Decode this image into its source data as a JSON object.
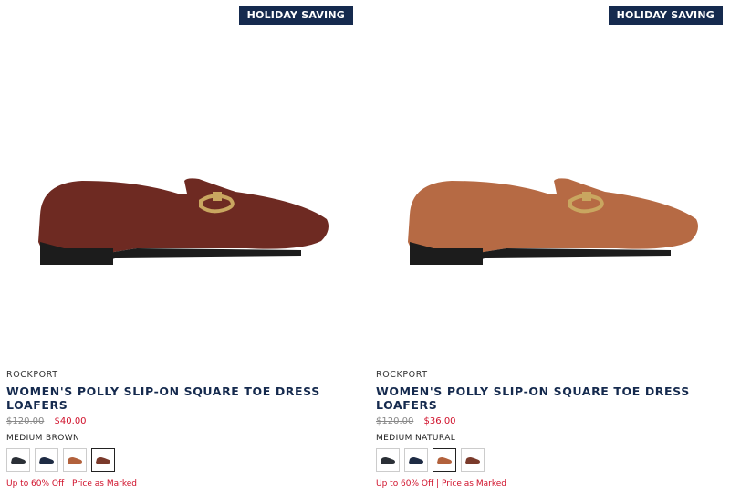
{
  "products": [
    {
      "badge": "HOLIDAY SAVING",
      "brand": "ROCKPORT",
      "title": "WOMEN'S POLLY SLIP-ON SQUARE TOE DRESS LOAFERS",
      "original_price": "$120.00",
      "sale_price": "$40.00",
      "color_label": "MEDIUM BROWN",
      "shoe_color": "#6e2a22",
      "swatches": [
        {
          "color": "#2a2f36",
          "selected": false
        },
        {
          "color": "#1e2b44",
          "selected": false
        },
        {
          "color": "#b2613c",
          "selected": false
        },
        {
          "color": "#7a3a2b",
          "selected": true
        }
      ],
      "promo": "Up to 60% Off | Price as Marked"
    },
    {
      "badge": "HOLIDAY SAVING",
      "brand": "ROCKPORT",
      "title": "WOMEN'S POLLY SLIP-ON SQUARE TOE DRESS LOAFERS",
      "original_price": "$120.00",
      "sale_price": "$36.00",
      "color_label": "MEDIUM NATURAL",
      "shoe_color": "#b66a44",
      "swatches": [
        {
          "color": "#2a2f36",
          "selected": false
        },
        {
          "color": "#1e2b44",
          "selected": false
        },
        {
          "color": "#b2613c",
          "selected": true
        },
        {
          "color": "#7a3a2b",
          "selected": false
        }
      ],
      "promo": "Up to 60% Off | Price as Marked"
    }
  ]
}
